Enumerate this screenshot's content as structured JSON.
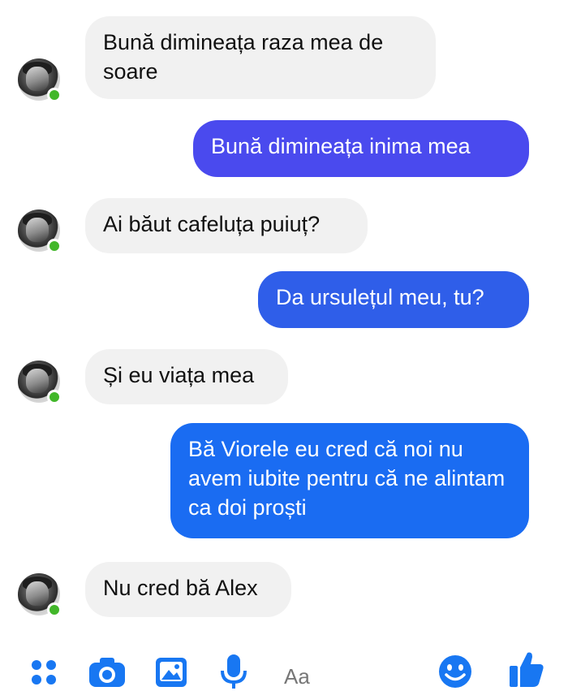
{
  "messages": [
    {
      "side": "in",
      "text": "Bună dimineața raza mea de soare"
    },
    {
      "side": "out",
      "text": "Bună dimineața inima mea",
      "color": "#4a4aee"
    },
    {
      "side": "in",
      "text": "Ai băut cafeluța puiuț?"
    },
    {
      "side": "out",
      "text": "Da ursulețul meu, tu?",
      "color": "#2f5ee9"
    },
    {
      "side": "in",
      "text": "Și eu viața mea"
    },
    {
      "side": "out",
      "text": "Bă Viorele eu cred că noi nu avem iubite pentru că ne alintam ca doi proști",
      "color": "#1a6cf2"
    },
    {
      "side": "in",
      "text": "Nu cred bă Alex"
    }
  ],
  "composer": {
    "placeholder": "Aa",
    "icons": [
      "grid-icon",
      "camera-icon",
      "image-icon",
      "microphone-icon",
      "emoji-icon",
      "thumbs-up-icon"
    ],
    "accent": "#1877f2"
  },
  "colors": {
    "incoming_bubble": "#f1f1f1",
    "online": "#42b72a"
  }
}
